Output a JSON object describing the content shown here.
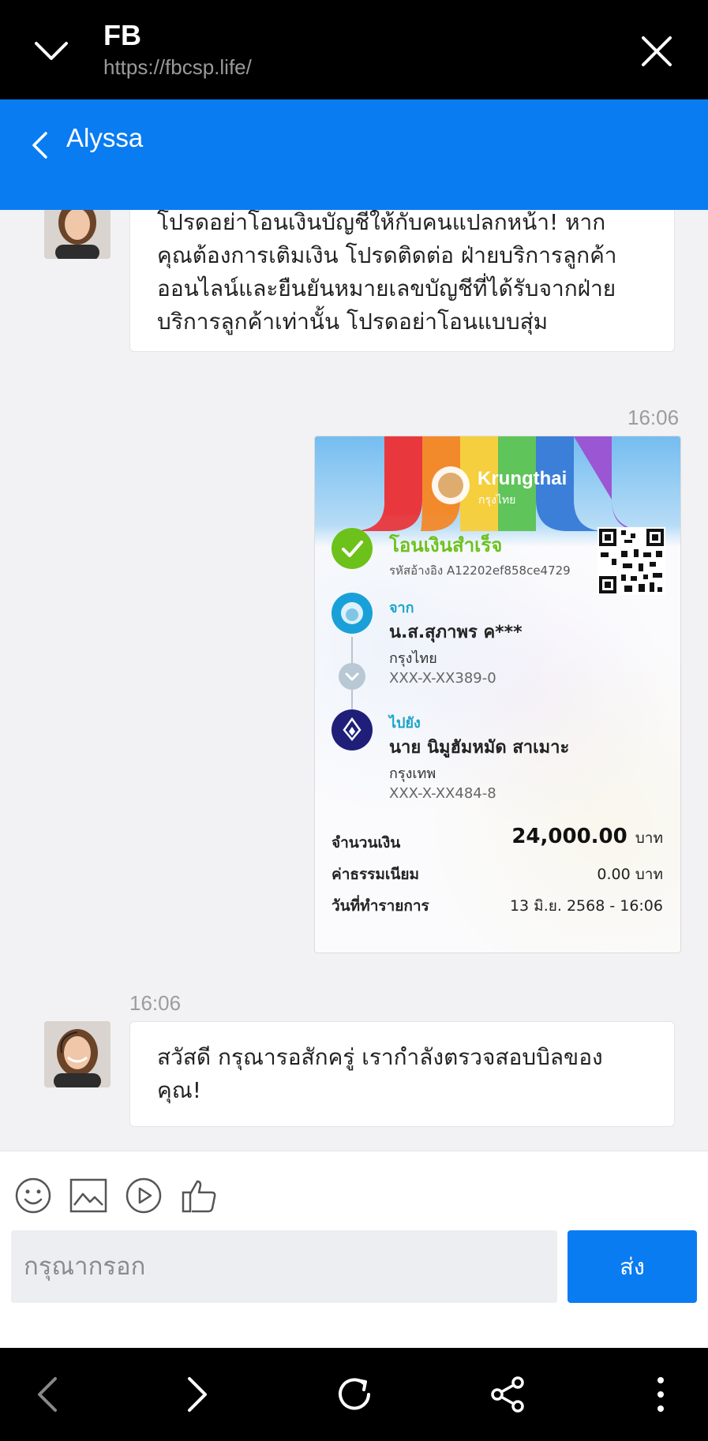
{
  "browser": {
    "site_title": "FB",
    "url": "https://fbcsp.life/"
  },
  "chat_header": {
    "contact_name": "Alyssa"
  },
  "messages": [
    {
      "type": "text",
      "from": "agent",
      "lines": [
        "โปรดอย่าโอนเงินบัญชีให้กับคนแปลกหน้า! หาก",
        "คุณต้องการเติมเงิน โปรดติดต่อ ฝ่ายบริการลูกค้า",
        "ออนไลน์และยืนยันหมายเลขบัญชีที่ได้รับจากฝ่าย",
        "บริการลูกค้าเท่านั้น โปรดอย่าโอนแบบสุ่ม"
      ]
    },
    {
      "type": "image",
      "from": "user",
      "time": "16:06",
      "receipt": {
        "bank_logo_text": "Krungthai",
        "bank_logo_sub": "กรุงไทย",
        "status": "โอนเงินสำเร็จ",
        "reference": "รหัสอ้างอิง A12202ef858ce4729",
        "from_label": "จาก",
        "from_name": "น.ส.สุภาพร ค***",
        "from_bank": "กรุงไทย",
        "from_account": "XXX-X-XX389-0",
        "to_label": "ไปยัง",
        "to_name": "นาย นิมูฮัมหมัด สาเมาะ",
        "to_bank": "กรุงเทพ",
        "to_account": "XXX-X-XX484-8",
        "amount_label": "จำนวนเงิน",
        "amount_value": "24,000.00",
        "amount_unit": "บาท",
        "fee_label": "ค่าธรรมเนียม",
        "fee_value": "0.00 บาท",
        "date_label": "วันที่ทำรายการ",
        "date_value": "13 มิ.ย. 2568 - 16:06"
      }
    },
    {
      "type": "text",
      "from": "agent",
      "time": "16:06",
      "lines": [
        "สวัสดี กรุณารอสักครู่ เรากำลังตรวจสอบบิลของ",
        "คุณ!"
      ]
    }
  ],
  "composer": {
    "placeholder": "กรุณากรอก",
    "send_label": "ส่ง",
    "tools": [
      "emoji-icon",
      "image-icon",
      "video-icon",
      "thumbs-up-icon"
    ]
  },
  "browser_nav": {
    "buttons": [
      "back-icon",
      "forward-icon",
      "reload-icon",
      "share-icon",
      "more-icon"
    ]
  },
  "colors": {
    "accent": "#0a7cf2",
    "success": "#6cc21a",
    "teal": "#1aa3c8"
  }
}
